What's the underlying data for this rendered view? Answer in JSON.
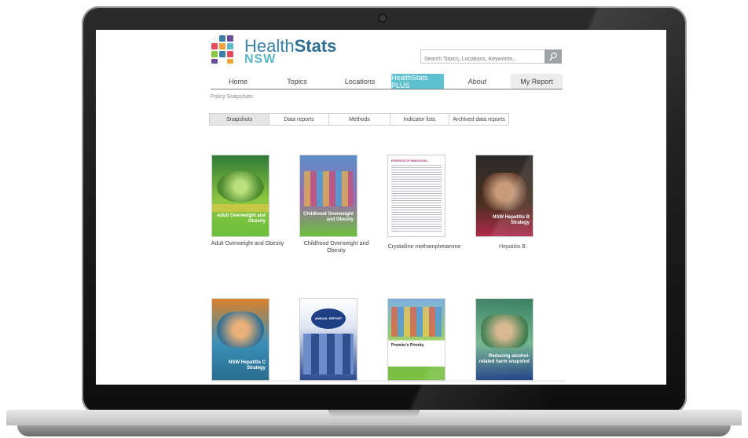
{
  "site": {
    "logo_main": "Health",
    "logo_bold": "Stats",
    "logo_sub": "NSW",
    "logo_colors": [
      "#3a7fa8",
      "#e64b5a",
      "#f1a33a",
      "#5cb8c6",
      "#8dc63f",
      "#6a4c9c"
    ]
  },
  "search": {
    "placeholder": "Search Topics, Locations, Keywords...",
    "icon": "search-icon"
  },
  "nav": {
    "items": [
      {
        "label": "Home"
      },
      {
        "label": "Topics"
      },
      {
        "label": "Locations"
      },
      {
        "label": "HealthStats PLUS"
      },
      {
        "label": "About"
      },
      {
        "label": "My Report"
      }
    ],
    "active_color": "#5fc0cf"
  },
  "breadcrumb": "Policy Snapshots",
  "tabs": [
    {
      "label": "Snapshots"
    },
    {
      "label": "Data reports"
    },
    {
      "label": "Methods"
    },
    {
      "label": "Indicator lists"
    },
    {
      "label": "Archived data reports"
    }
  ],
  "reports": [
    {
      "label": "Adult Overweight and Obesity",
      "cover_title": "Adult Overweight and Obesity"
    },
    {
      "label": "Childhood Overweight and Obesity",
      "cover_title": "Childhood Overweight and Obesity"
    },
    {
      "label": "Crystalline methamphetamine",
      "cover_title": "EVIDENCE OF MARIJUANA..."
    },
    {
      "label": "Hepatitis B",
      "cover_title": "NSW Hepatitis B Strategy"
    },
    {
      "label": "",
      "cover_title": "NSW Hepatitis C Strategy"
    },
    {
      "label": "",
      "cover_title": "ANNUAL REPORT"
    },
    {
      "label": "",
      "cover_title": "Premier's Priority"
    },
    {
      "label": "",
      "cover_title": "Reducing alcohol-related harm snapshot"
    }
  ]
}
